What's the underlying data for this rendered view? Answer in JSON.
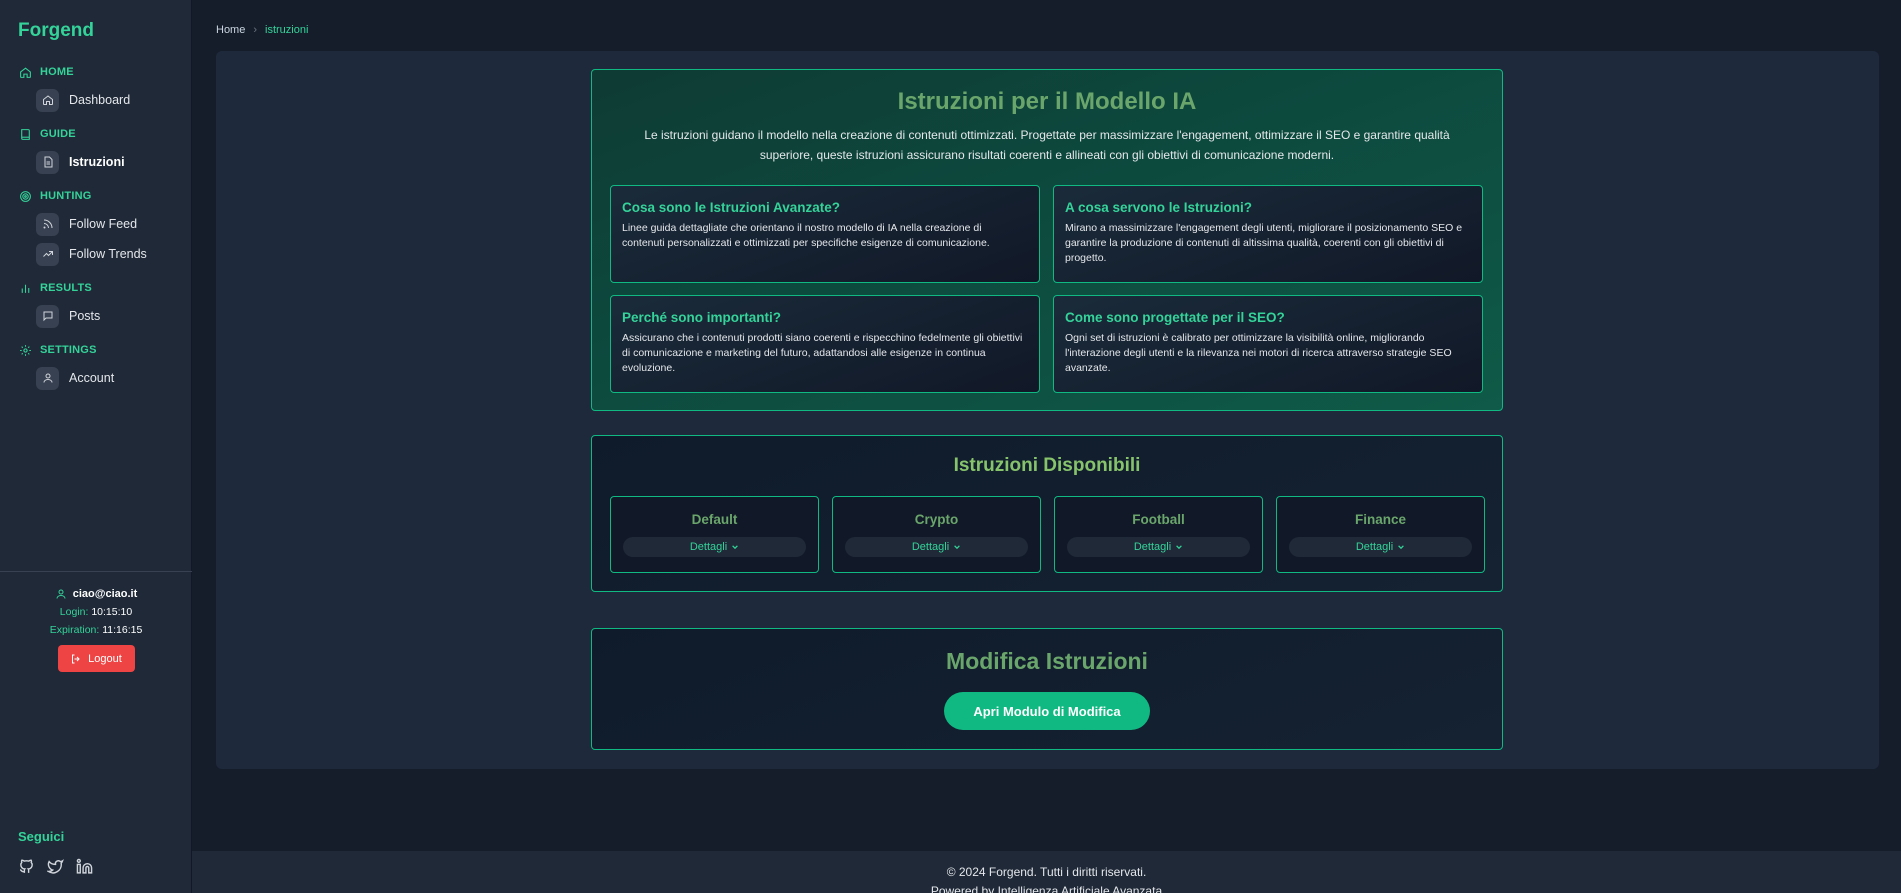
{
  "brand": "Forgend",
  "colors": {
    "accent": "#34d399",
    "accent_strong": "#10b981",
    "danger": "#ef4444"
  },
  "sidebar": {
    "sections": [
      {
        "title": "HOME",
        "icon": "home-icon",
        "items": [
          {
            "label": "Dashboard",
            "icon": "home-icon"
          }
        ]
      },
      {
        "title": "GUIDE",
        "icon": "book-icon",
        "items": [
          {
            "label": "Istruzioni",
            "icon": "document-icon",
            "active": true
          }
        ]
      },
      {
        "title": "HUNTING",
        "icon": "target-icon",
        "items": [
          {
            "label": "Follow Feed",
            "icon": "rss-icon"
          },
          {
            "label": "Follow Trends",
            "icon": "trending-up-icon"
          }
        ]
      },
      {
        "title": "RESULTS",
        "icon": "bar-chart-icon",
        "items": [
          {
            "label": "Posts",
            "icon": "message-square-icon"
          }
        ]
      },
      {
        "title": "SETTINGS",
        "icon": "gear-icon",
        "items": [
          {
            "label": "Account",
            "icon": "user-icon"
          }
        ]
      }
    ],
    "user": {
      "email": "ciao@ciao.it",
      "login_label": "Login:",
      "login_time": "10:15:10",
      "expiration_label": "Expiration:",
      "expiration_time": "11:16:15",
      "logout_label": "Logout"
    },
    "social": {
      "title": "Seguici",
      "icons": [
        "github-icon",
        "twitter-icon",
        "linkedin-icon"
      ]
    }
  },
  "breadcrumb": {
    "home": "Home",
    "current": "istruzioni"
  },
  "intro_card": {
    "title": "Istruzioni per il Modello IA",
    "text": "Le istruzioni guidano il modello nella creazione di contenuti ottimizzati. Progettate per massimizzare l'engagement, ottimizzare il SEO e garantire qualità superiore, queste istruzioni assicurano risultati coerenti e allineati con gli obiettivi di comunicazione moderni.",
    "boxes": [
      {
        "title": "Cosa sono le Istruzioni Avanzate?",
        "text": "Linee guida dettagliate che orientano il nostro modello di IA nella creazione di contenuti personalizzati e ottimizzati per specifiche esigenze di comunicazione."
      },
      {
        "title": "A cosa servono le Istruzioni?",
        "text": "Mirano a massimizzare l'engagement degli utenti, migliorare il posizionamento SEO e garantire la produzione di contenuti di altissima qualità, coerenti con gli obiettivi di progetto."
      },
      {
        "title": "Perché sono importanti?",
        "text": "Assicurano che i contenuti prodotti siano coerenti e rispecchino fedelmente gli obiettivi di comunicazione e marketing del futuro, adattandosi alle esigenze in continua evoluzione."
      },
      {
        "title": "Come sono progettate per il SEO?",
        "text": "Ogni set di istruzioni è calibrato per ottimizzare la visibilità online, migliorando l'interazione degli utenti e la rilevanza nei motori di ricerca attraverso strategie SEO avanzate."
      }
    ]
  },
  "available": {
    "title": "Istruzioni Disponibili",
    "details_label": "Dettagli",
    "presets": [
      "Default",
      "Crypto",
      "Football",
      "Finance"
    ]
  },
  "edit": {
    "title": "Modifica Istruzioni",
    "button": "Apri Modulo di Modifica"
  },
  "footer": {
    "line1": "© 2024 Forgend. Tutti i diritti riservati.",
    "line2": "Powered by Intelligenza Artificiale Avanzata"
  }
}
